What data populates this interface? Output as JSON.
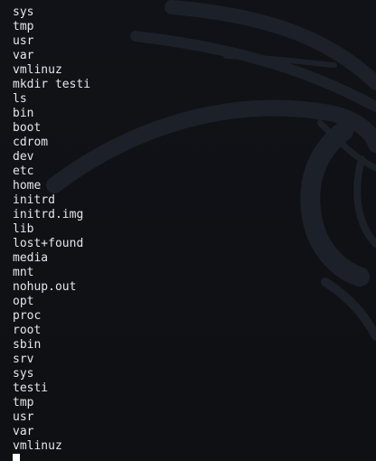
{
  "terminal": {
    "lines": [
      "sys",
      "tmp",
      "usr",
      "var",
      "vmlinuz",
      "mkdir testi",
      "ls",
      "bin",
      "boot",
      "cdrom",
      "dev",
      "etc",
      "home",
      "initrd",
      "initrd.img",
      "lib",
      "lost+found",
      "media",
      "mnt",
      "nohup.out",
      "opt",
      "proc",
      "root",
      "sbin",
      "srv",
      "sys",
      "testi",
      "tmp",
      "usr",
      "var",
      "vmlinuz"
    ]
  },
  "colors": {
    "background": "#0e1014",
    "text": "#e3e6ea",
    "watermark": "#1c2029",
    "cursor": "#ffffff"
  },
  "icons": {
    "watermark": "kali-dragon-watermark-icon"
  }
}
